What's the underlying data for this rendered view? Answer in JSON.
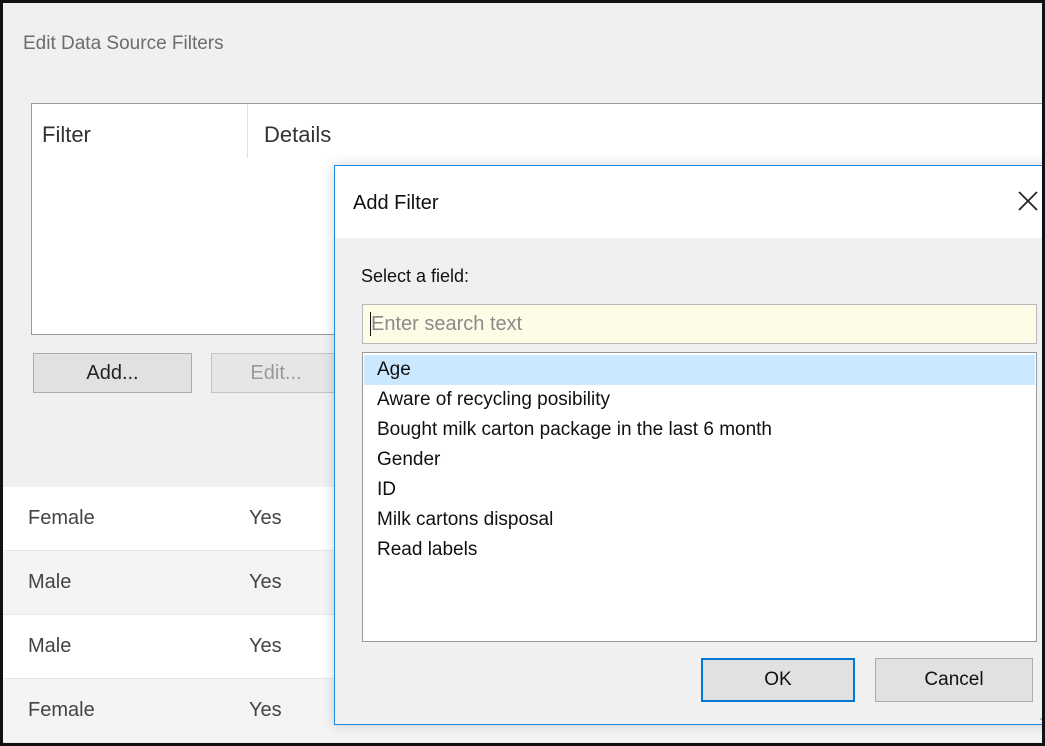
{
  "base_dialog": {
    "title": "Edit Data Source Filters",
    "columns": [
      "Filter",
      "Details"
    ],
    "add_label": "Add...",
    "edit_label": "Edit..."
  },
  "data_rows": [
    {
      "gender": "Female",
      "aware": "Yes"
    },
    {
      "gender": "Male",
      "aware": "Yes"
    },
    {
      "gender": "Male",
      "aware": "Yes"
    },
    {
      "gender": "Female",
      "aware": "Yes"
    }
  ],
  "add_filter_dialog": {
    "title": "Add Filter",
    "close_icon": "close-icon",
    "field_label": "Select a field:",
    "search_placeholder": "Enter search text",
    "search_value": "",
    "fields": [
      "Age",
      "Aware of recycling posibility",
      "Bought milk carton package in the last 6 month",
      "Gender",
      "ID",
      "Milk cartons disposal",
      "Read labels"
    ],
    "selected_field": "Age",
    "ok_label": "OK",
    "cancel_label": "Cancel"
  },
  "colors": {
    "dialog_bg": "#f0f0f0",
    "selection": "#cce8ff",
    "accent": "#0078d7",
    "search_bg": "#fdfde7"
  }
}
